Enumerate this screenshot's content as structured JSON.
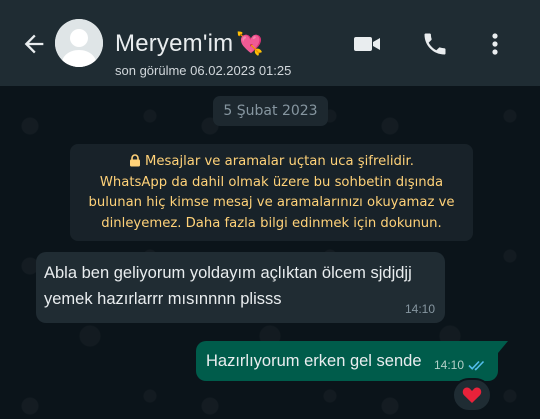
{
  "header": {
    "contact_name": "Meryem'im",
    "name_emoji": "💘",
    "last_seen": "son görülme 06.02.2023 01:25",
    "icons": [
      "back-arrow-icon",
      "avatar",
      "video-call-icon",
      "voice-call-icon",
      "more-vert-icon"
    ]
  },
  "chat": {
    "date_chip": "5 Şubat 2023",
    "encryption_notice": {
      "line1": "Mesajlar ve aramalar uçtan uca şifrelidir.",
      "line2": "WhatsApp da dahil olmak üzere bu sohbetin dışında",
      "line3": "bulunan hiç kimse mesaj ve aramalarınızı okuyamaz ve",
      "line4": "dinleyemez. Daha fazla bilgi edinmek için dokunun."
    },
    "messages": [
      {
        "direction": "incoming",
        "line1": "Abla ben geliyorum yoldayım açlıktan ölcem sjdjdjj",
        "line2": "yemek hazırlarrr mısınnnn plisss",
        "time": "14:10"
      },
      {
        "direction": "outgoing",
        "text": "Hazırlıyorum erken gel sende",
        "time": "14:10",
        "status": "read",
        "reaction": "❤️"
      }
    ]
  },
  "colors": {
    "header_bg": "#1f2c33",
    "chat_bg": "#0b141a",
    "incoming_bubble": "#202c33",
    "outgoing_bubble": "#005c4b",
    "notice_text": "#ffd279",
    "read_ticks": "#53bdeb"
  }
}
